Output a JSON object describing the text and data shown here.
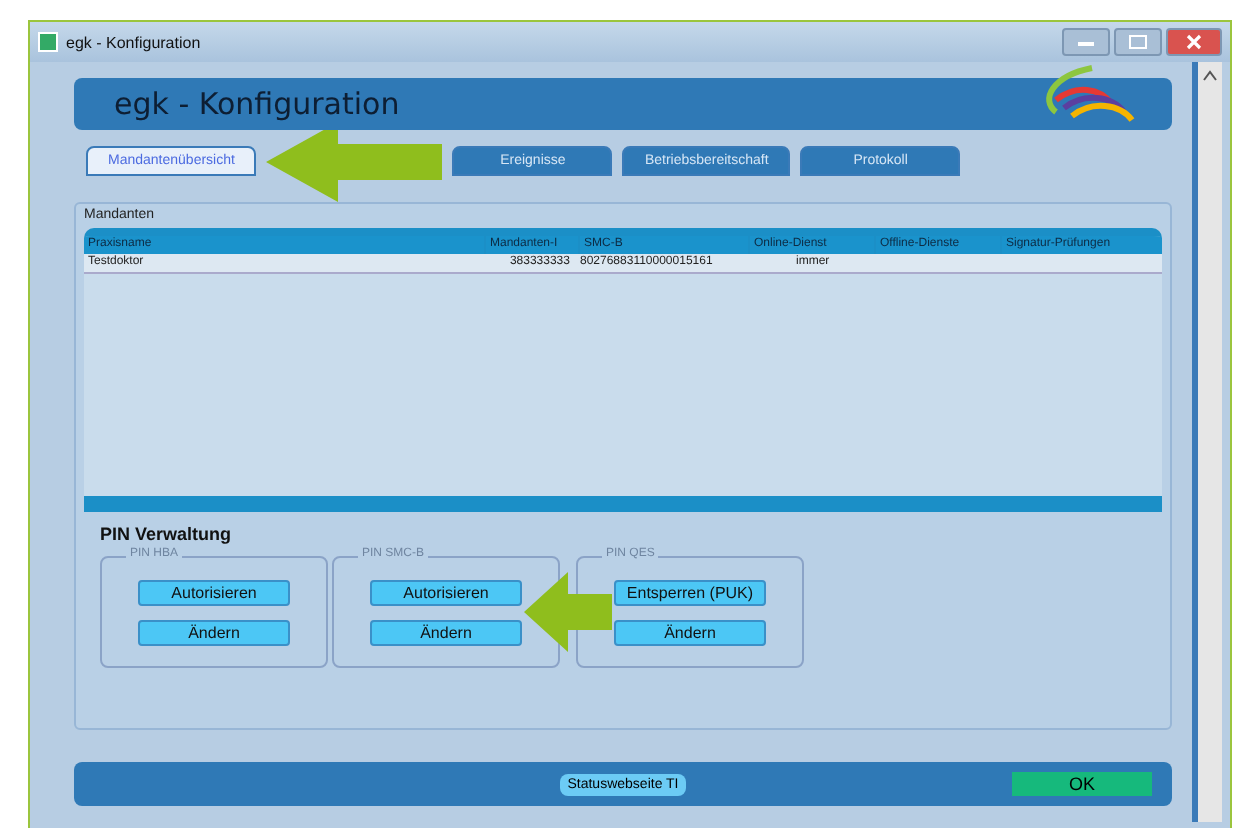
{
  "window": {
    "title": "egk - Konfiguration"
  },
  "header": {
    "title": "egk - Konfiguration"
  },
  "tabs": [
    {
      "label": "Mandantenübersicht",
      "selected": true
    },
    {
      "label": "Ereignisse",
      "selected": false
    },
    {
      "label": "Betriebsbereitschaft",
      "selected": false
    },
    {
      "label": "Protokoll",
      "selected": false
    }
  ],
  "mandanten": {
    "label": "Mandanten",
    "columns": [
      "Praxisname",
      "Mandanten-I",
      "SMC-B",
      "Online-Dienst",
      "Offline-Dienste",
      "Signatur-Prüfungen"
    ],
    "rows": [
      [
        "Testdoktor",
        "383333333",
        "80276883110000015161",
        "immer",
        "",
        ""
      ]
    ]
  },
  "pin": {
    "title": "PIN Verwaltung",
    "groups": [
      {
        "label": "PIN HBA",
        "buttons": [
          "Autorisieren",
          "Ändern"
        ]
      },
      {
        "label": "PIN SMC-B",
        "buttons": [
          "Autorisieren",
          "Ändern"
        ]
      },
      {
        "label": "PIN QES",
        "buttons": [
          "Entsperren (PUK)",
          "Ändern"
        ]
      }
    ]
  },
  "footer": {
    "status_button": "Statuswebseite TI",
    "ok_button": "OK"
  }
}
